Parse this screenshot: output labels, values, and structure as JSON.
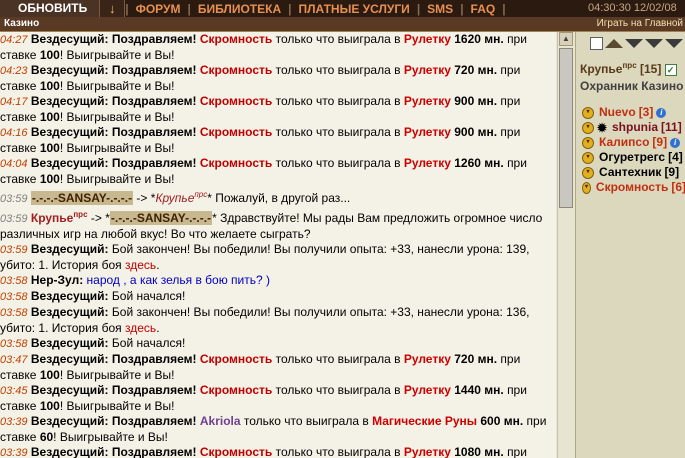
{
  "topbar": {
    "refresh_label": "ОБНОВИТЬ",
    "arrow": "↓",
    "menu": [
      "ФОРУМ",
      "БИБЛИОТЕКА",
      "ПЛАТНЫЕ УСЛУГИ",
      "SMS",
      "FAQ"
    ],
    "clock": "04:30:30   12/02/08"
  },
  "stripe": {
    "title": "Казино",
    "right_text": "Играть   на Главной"
  },
  "chat": [
    {
      "time": "04:27",
      "player": "Скромность",
      "game": "Рулетку",
      "amount": "1620 мн.",
      "stake": "100"
    },
    {
      "time": "04:23",
      "player": "Скромность",
      "game": "Рулетку",
      "amount": "720 мн.",
      "stake": "100"
    },
    {
      "time": "04:17",
      "player": "Скромность",
      "game": "Рулетку",
      "amount": "900 мн.",
      "stake": "100"
    },
    {
      "time": "04:16",
      "player": "Скромность",
      "game": "Рулетку",
      "amount": "900 мн.",
      "stake": "100"
    },
    {
      "time": "04:04",
      "player": "Скромность",
      "game": "Рулетку",
      "amount": "1260 мн.",
      "stake": "100"
    }
  ],
  "texts": {
    "author": "Вездесущий:",
    "congrats": "Поздравляем!",
    "won": "только что выиграла в",
    "at_stake": "при ставке",
    "win_tail": "! Выигрывайте и Вы!",
    "arrow_to": " -> *",
    "sansay": "-.-.-.-SANSAY-.-.-.-",
    "krupye": "Крупье",
    "prs": "прс",
    "krupye_reply": "* Пожалуй, в другой раз...",
    "krupye_greet": "* Здравствуйте! Мы рады Вам предложить огромное число различных игр на любой вкус! Во что желаете сыграть?",
    "battle_end_1": "Бой закончен! Вы победили! Вы получили опыта: +33, нанесли урона: 139, убито: 1. История боя ",
    "battle_end_2": "Бой закончен! Вы победили! Вы получили опыта: +33, нанесли урона: 136, убито: 1. История боя ",
    "here": "здесь",
    "dot": ".",
    "battle_start": "Бой начался!",
    "nerzul": "Нер-Зул:",
    "nerzul_msg": "народ , а как зелья в бою пить? )",
    "akriola": "Akriola",
    "magic_runes": "Магические Руны",
    "amt600": "600 мн.",
    "stake60": "60",
    "t0359a": "03:59",
    "t0359b": "03:59",
    "t0359c": "03:59",
    "t0358a": "03:58",
    "t0358b": "03:58",
    "t0358c": "03:58",
    "t0358d": "03:58",
    "t0347a": "03:47",
    "t0347b": "03:47",
    "t0345": "03:45",
    "t0339a": "03:39",
    "t0339b": "03:39",
    "amt720": "720 мн.",
    "amt1440": "1440 мн.",
    "amt1080": "1080 мн.",
    "stake100": "100",
    "roulette": "Рулетку",
    "skromnost": "Скромность"
  },
  "right": {
    "location_name": "Крупье",
    "location_sup": "прс",
    "location_count": "[15]",
    "guard": "Охранник Казино",
    "users": [
      {
        "name": "Nuevo",
        "level": "[3]",
        "info": true,
        "gear": false,
        "color": "red"
      },
      {
        "name": "shpunia",
        "level": "[11]",
        "info": false,
        "gear": true,
        "color": "purple"
      },
      {
        "name": "Калипсо",
        "level": "[9]",
        "info": true,
        "gear": false,
        "color": "red"
      },
      {
        "name": "Огуретрегс",
        "level": "[4]",
        "info": false,
        "gear": false,
        "color": "black"
      },
      {
        "name": "Сантехник",
        "level": "[9]",
        "info": false,
        "gear": false,
        "color": "black"
      },
      {
        "name": "Скромность",
        "level": "[6]",
        "info": false,
        "gear": false,
        "color": "red"
      }
    ]
  }
}
